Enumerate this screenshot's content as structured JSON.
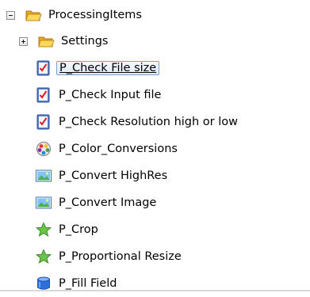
{
  "tree": {
    "root": {
      "label": "ProcessingItems",
      "icon": "folder-open-icon",
      "expander": "collapse"
    },
    "settings": {
      "label": "Settings",
      "icon": "folder-icon",
      "expander": "expand"
    },
    "items": [
      {
        "label": "P_Check File size",
        "icon": "checklist-icon",
        "selected": true
      },
      {
        "label": "P_Check Input file",
        "icon": "checklist-icon"
      },
      {
        "label": "P_Check Resolution high or low",
        "icon": "checklist-icon"
      },
      {
        "label": "P_Color_Conversions",
        "icon": "color-wheel-icon"
      },
      {
        "label": "P_Convert HighRes",
        "icon": "image-icon"
      },
      {
        "label": "P_Convert Image",
        "icon": "image-icon"
      },
      {
        "label": "P_Crop",
        "icon": "star-icon"
      },
      {
        "label": "P_Proportional Resize",
        "icon": "star-icon"
      },
      {
        "label": "P_Fill Field",
        "icon": "paint-bucket-icon"
      }
    ]
  }
}
